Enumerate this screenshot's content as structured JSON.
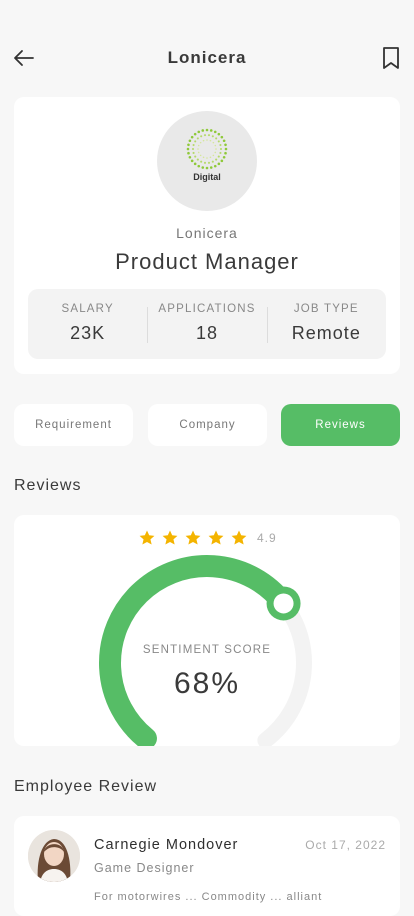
{
  "header": {
    "title": "Lonicera",
    "back_icon": "arrow-left-icon",
    "bookmark_icon": "bookmark-icon"
  },
  "job": {
    "logo_text": "Digital",
    "logo_subtext": "",
    "company": "Lonicera",
    "title": "Product Manager",
    "stats": [
      {
        "label": "SALARY",
        "value": "23K"
      },
      {
        "label": "APPLICATIONS",
        "value": "18"
      },
      {
        "label": "JOB TYPE",
        "value": "Remote"
      }
    ]
  },
  "tabs": [
    {
      "label": "Requirement",
      "active": false
    },
    {
      "label": "Company",
      "active": false
    },
    {
      "label": "Reviews",
      "active": true
    }
  ],
  "reviews": {
    "section_title": "Reviews",
    "stars": 5,
    "rating": "4.9",
    "sentiment_label": "SENTIMENT SCORE",
    "sentiment_value": "68%",
    "sentiment_fraction": 0.68
  },
  "employee_review": {
    "section_title": "Employee Review",
    "name": "Carnegie Mondover",
    "role": "Game Designer",
    "date": "Oct 17, 2022",
    "text": "For motorwires ... Commodity ... alliant"
  },
  "colors": {
    "accent": "#56bd66",
    "star": "#f4b400",
    "track": "#f3f3f3"
  }
}
